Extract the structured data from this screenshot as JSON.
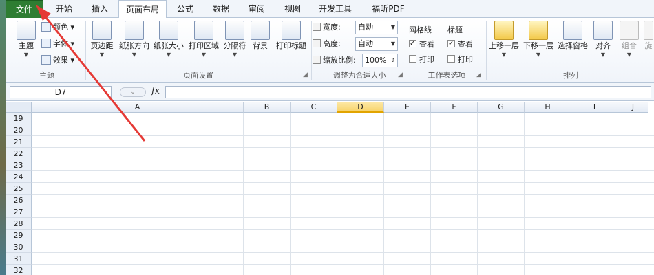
{
  "tabs": [
    {
      "label": "文件"
    },
    {
      "label": "开始"
    },
    {
      "label": "插入"
    },
    {
      "label": "页面布局"
    },
    {
      "label": "公式"
    },
    {
      "label": "数据"
    },
    {
      "label": "审阅"
    },
    {
      "label": "视图"
    },
    {
      "label": "开发工具"
    },
    {
      "label": "福昕PDF"
    }
  ],
  "ribbon": {
    "theme_group": {
      "label": "主题",
      "theme_btn": "主题",
      "colors": "颜色",
      "fonts": "字体",
      "effects": "效果"
    },
    "page_setup_group": {
      "label": "页面设置",
      "margins": "页边距",
      "orientation": "纸张方向",
      "size": "纸张大小",
      "print_area": "打印区域",
      "breaks": "分隔符",
      "background": "背景",
      "print_titles": "打印标题"
    },
    "scale_group": {
      "label": "调整为合适大小",
      "width_label": "宽度:",
      "width_value": "自动",
      "height_label": "高度:",
      "height_value": "自动",
      "scale_label": "缩放比例:",
      "scale_value": "100%"
    },
    "sheet_options_group": {
      "label": "工作表选项",
      "gridlines": "网格线",
      "headings": "标题",
      "view": "查看",
      "print": "打印"
    },
    "arrange_group": {
      "label": "排列",
      "bring_forward": "上移一层",
      "send_backward": "下移一层",
      "selection_pane": "选择窗格",
      "align": "对齐",
      "group": "组合",
      "rotate": "旋"
    }
  },
  "formula_bar": {
    "cell_ref": "D7",
    "fx": "fx"
  },
  "columns": [
    "A",
    "B",
    "C",
    "D",
    "E",
    "F",
    "G",
    "H",
    "I",
    "J"
  ],
  "selected_column": "D",
  "rows": [
    "19",
    "20",
    "21",
    "22",
    "23",
    "24",
    "25",
    "26",
    "27",
    "28",
    "29",
    "30",
    "31",
    "32"
  ],
  "colors": {
    "file_tab": "#2e7d32",
    "arrow": "#e53935",
    "selected_header": "#f7d36b"
  }
}
